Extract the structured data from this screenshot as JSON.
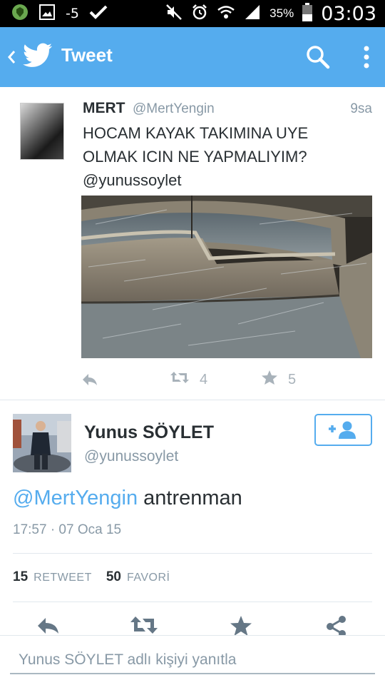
{
  "status_bar": {
    "temperature": "-5",
    "battery_percent": "35%",
    "time": "03:03",
    "icons": [
      "shield-app-icon",
      "gallery-icon",
      "check-icon",
      "mute-icon",
      "alarm-icon",
      "wifi-icon",
      "signal-icon",
      "battery-icon"
    ]
  },
  "appbar": {
    "title": "Tweet",
    "icons": [
      "back-icon",
      "twitter-bird-icon",
      "search-icon",
      "overflow-menu-icon"
    ],
    "color": "#55acee"
  },
  "reply_to_tweet": {
    "name": "MERT",
    "handle": "@MertYengin",
    "time": "9sa",
    "text_line1": "HOCAM KAYAK TAKIMINA UYE",
    "text_line2": "OLMAK ICIN NE YAPMALIYIM?",
    "text_line3": "@yunussoylet",
    "retweets": "4",
    "favorites": "5"
  },
  "main_tweet": {
    "name": "Yunus SÖYLET",
    "handle": "@yunussoylet",
    "mention": "@MertYengin",
    "text": " antrenman",
    "timestamp": "17:57 · 07 Oca 15",
    "retweet_count": "15",
    "retweet_label": "RETWEET",
    "favorite_count": "50",
    "favorite_label": "FAVORİ",
    "follow_icon": "add-user-icon"
  },
  "action_bar": {
    "icons": [
      "reply-icon",
      "retweet-icon",
      "favorite-icon",
      "share-icon"
    ]
  },
  "reply_box": {
    "placeholder": "Yunus SÖYLET adlı kişiyi yanıtla"
  }
}
